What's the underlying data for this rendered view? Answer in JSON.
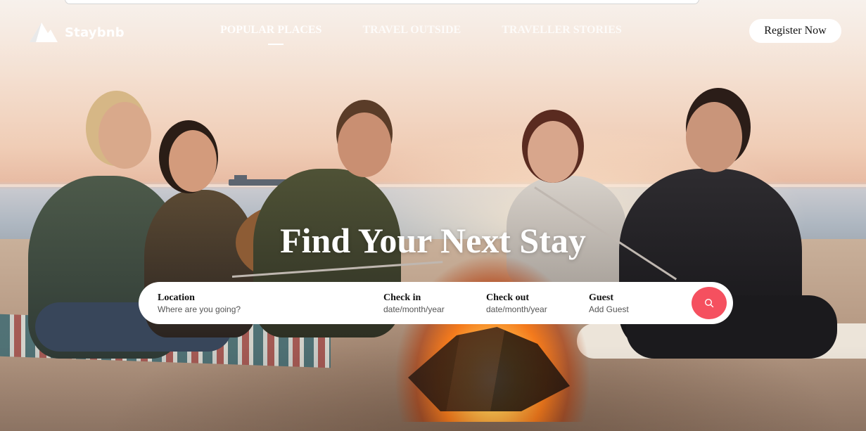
{
  "brand": {
    "name": "Staybnb"
  },
  "nav": {
    "items": [
      {
        "label": "POPULAR PLACES",
        "active": true
      },
      {
        "label": "TRAVEL OUTSIDE",
        "active": false
      },
      {
        "label": "TRAVELLER STORIES",
        "active": false
      }
    ],
    "register_label": "Register Now"
  },
  "hero": {
    "title": "Find Your Next Stay"
  },
  "search": {
    "location": {
      "label": "Location",
      "placeholder": "Where are you going?"
    },
    "check_in": {
      "label": "Check in",
      "placeholder": "date/month/year"
    },
    "check_out": {
      "label": "Check out",
      "placeholder": "date/month/year"
    },
    "guest": {
      "label": "Guest",
      "placeholder": "Add Guest"
    },
    "button_icon": "search-icon",
    "button_color": "#f5505f"
  }
}
